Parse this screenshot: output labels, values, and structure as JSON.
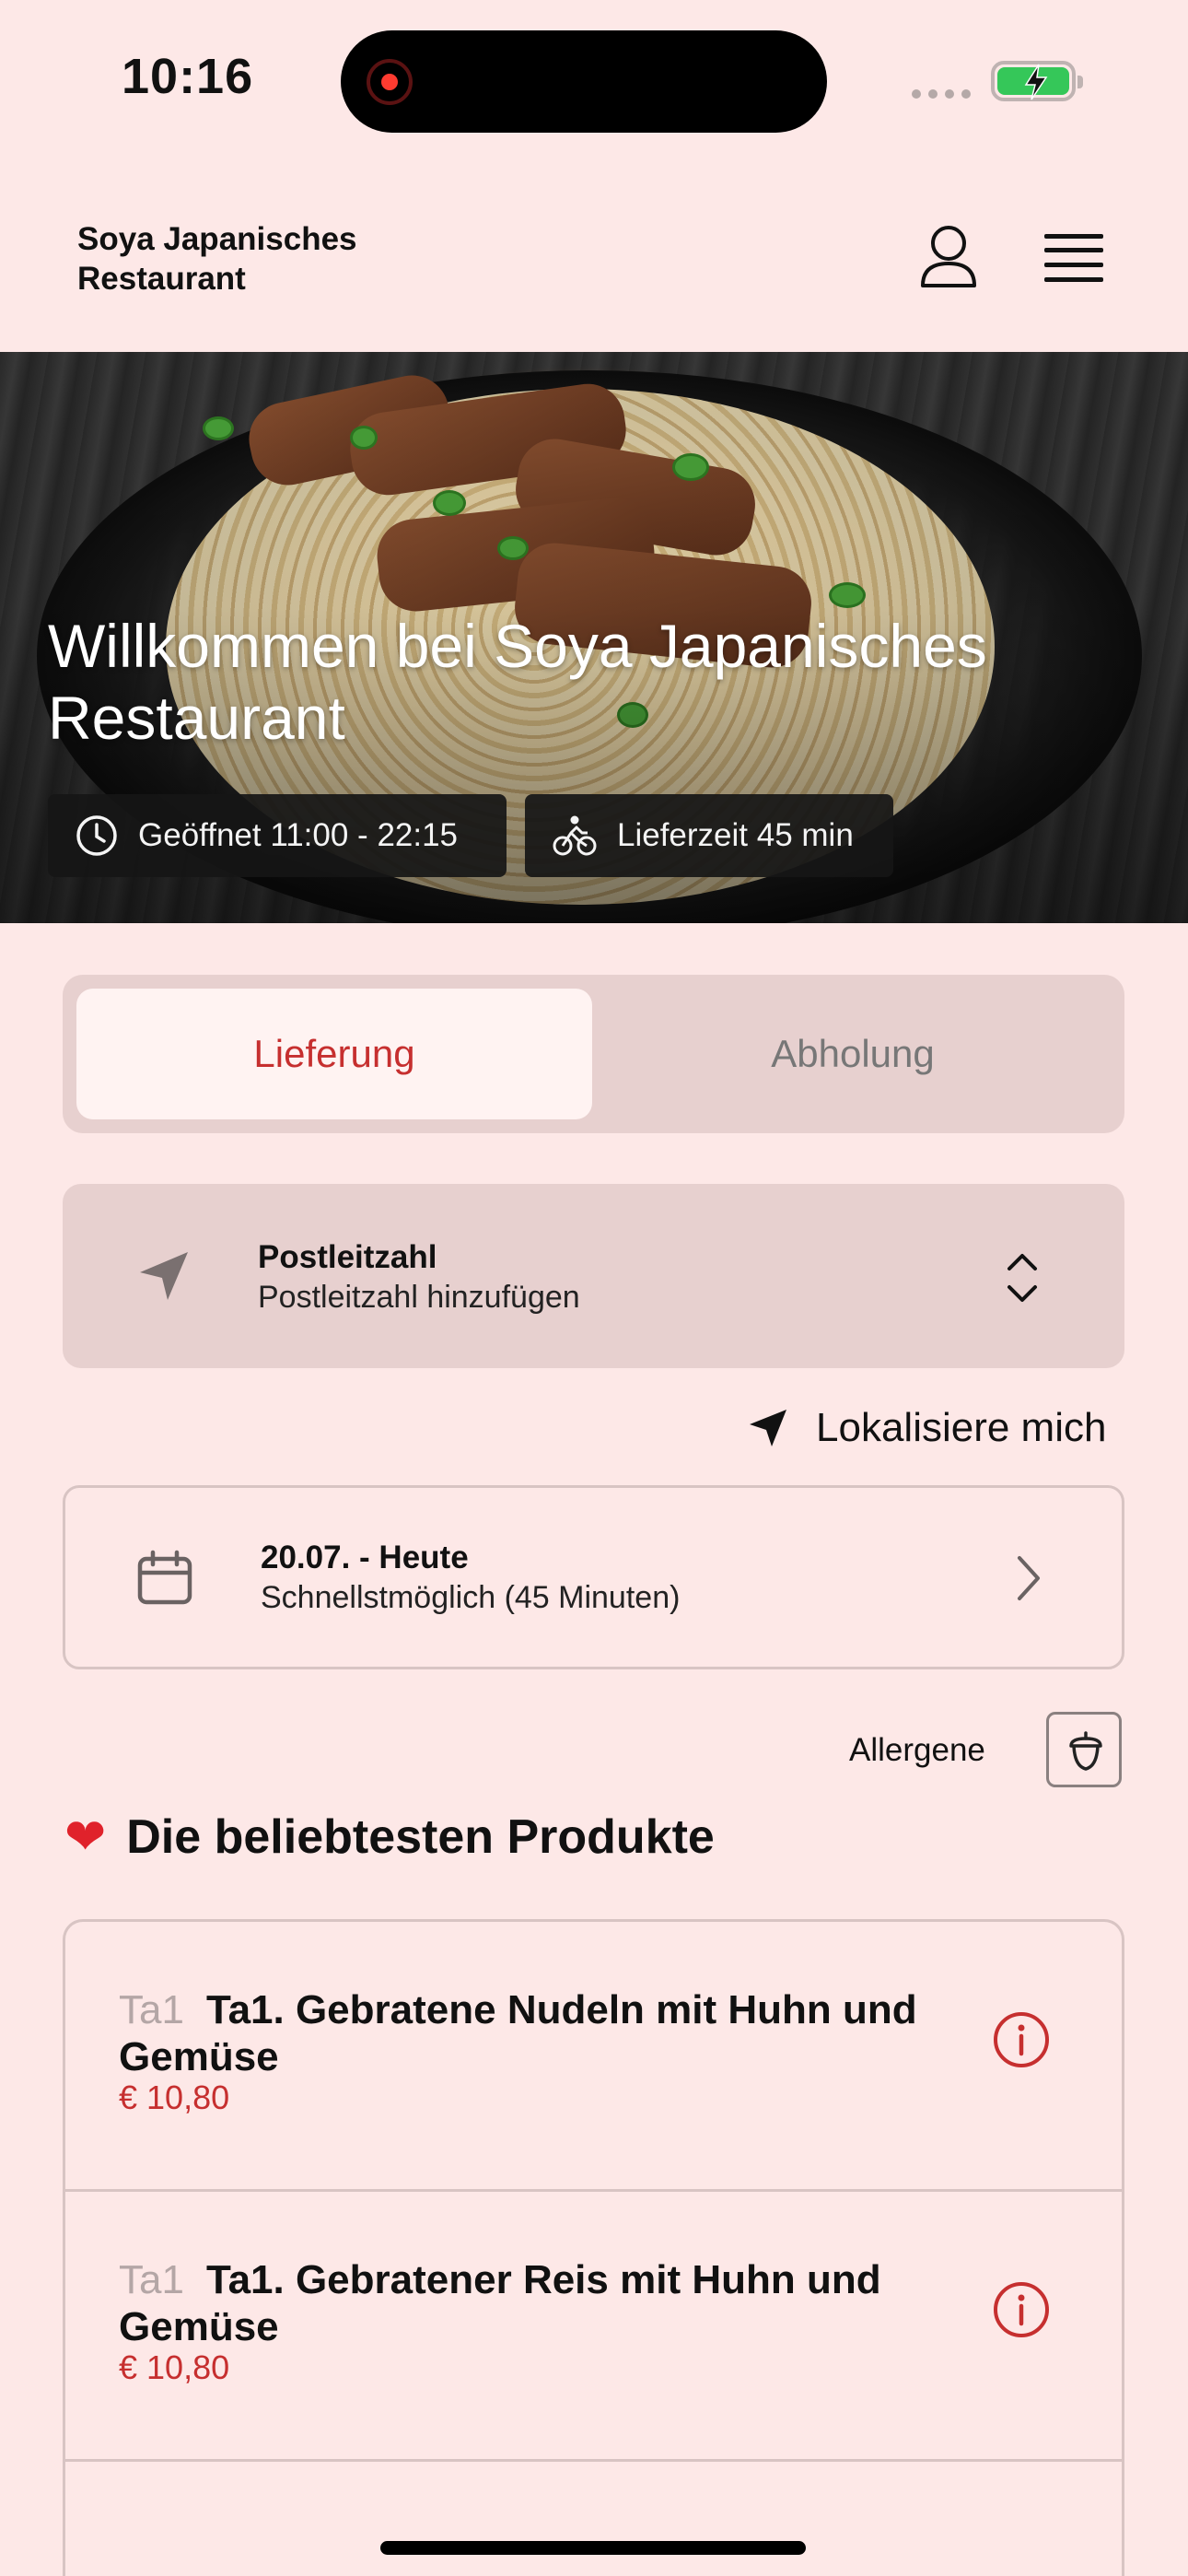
{
  "status_bar": {
    "time": "10:16"
  },
  "header": {
    "restaurant_name": "Soya Japanisches Restaurant"
  },
  "hero": {
    "title": "Willkommen bei Soya Japanisches Restaurant",
    "opening_hours": "Geöffnet 11:00 - 22:15",
    "delivery_time": "Lieferzeit 45 min"
  },
  "order_mode": {
    "tabs": [
      {
        "label": "Lieferung",
        "active": true
      },
      {
        "label": "Abholung",
        "active": false
      }
    ]
  },
  "postcode": {
    "label": "Postleitzahl",
    "placeholder": "Postleitzahl hinzufügen"
  },
  "locate": {
    "label": "Lokalisiere mich"
  },
  "schedule": {
    "date": "20.07. - Heute",
    "time": "Schnellstmöglich (45 Minuten)"
  },
  "allergens": {
    "label": "Allergene"
  },
  "popular": {
    "title": "Die beliebtesten Produkte",
    "products": [
      {
        "code": "Ta1",
        "name": "Ta1. Gebratene Nudeln mit Huhn und Gemüse",
        "price": "€ 10,80"
      },
      {
        "code": "Ta1",
        "name": "Ta1. Gebratener Reis mit Huhn und Gemüse",
        "price": "€ 10,80"
      }
    ]
  },
  "colors": {
    "background": "#fde8e7",
    "accent": "#c62f2f",
    "panel": "#e7d0cf"
  }
}
